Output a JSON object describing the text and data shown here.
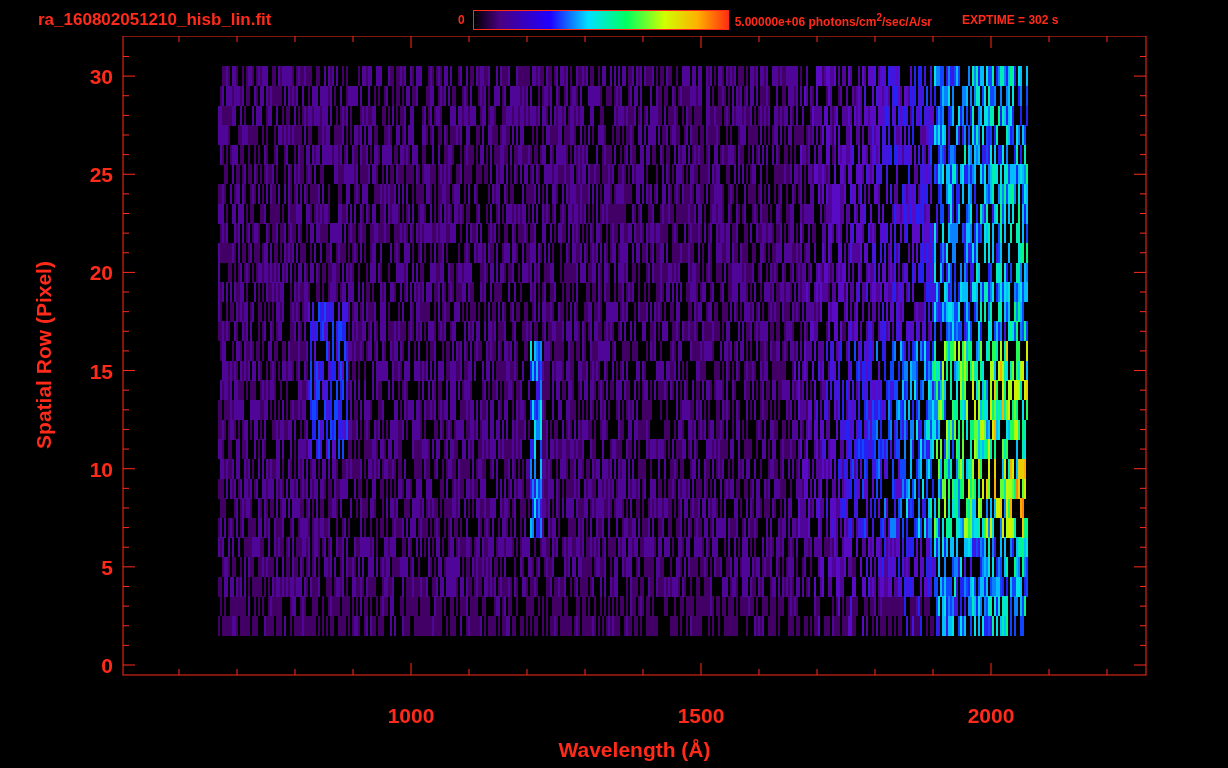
{
  "title": "ra_160802051210_hisb_lin.fit",
  "colorbar": {
    "min_label": "0",
    "max_label": "5.00000e+06 photons/cm$^{2}$/sec/A/sr"
  },
  "exposure": "EXPTIME = 302 s",
  "plot": {
    "xlabel": "Wavelength (Å)",
    "ylabel": "Spatial Row (Pixel)",
    "xticks": [
      "1000",
      "1500",
      "2000"
    ],
    "yticks": [
      "30",
      "25",
      "20",
      "15",
      "10",
      "5",
      "0"
    ]
  }
}
